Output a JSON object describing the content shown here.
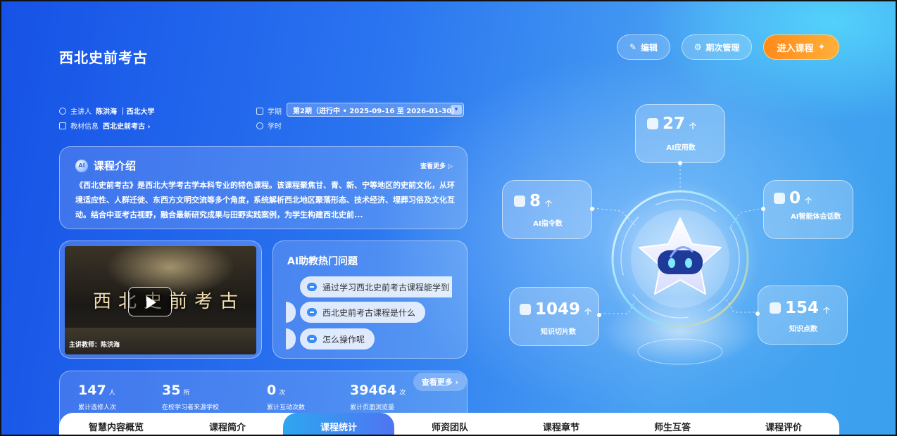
{
  "header": {
    "title": "西北史前考古",
    "edit_label": "编辑",
    "term_mgmt_label": "期次管理",
    "enter_course_label": "进入课程"
  },
  "meta": {
    "lecturer_key": "主讲人",
    "lecturer_value": "陈洪海 ｜西北大学",
    "textbook_key": "教材信息",
    "textbook_value": "西北史前考古 ›",
    "term_key": "学期",
    "term_value": "第2期（进行中 • 2025-09-16 至 2026-01-30）",
    "hours_key": "学时"
  },
  "intro": {
    "title": "课程介绍",
    "badge": "AI",
    "more": "查看更多 ▷",
    "body": "《西北史前考古》是西北大学考古学本科专业的特色课程。该课程聚焦甘、青、新、宁等地区的史前文化，从环境适应性、人群迁徙、东西方文明交流等多个角度，系统解析西北地区聚落形态、技术经济、埋葬习俗及文化互动。结合中亚考古视野，融合最新研究成果与田野实践案例，为学生构建西北史前..."
  },
  "video": {
    "overlay_title": "西北史前考古",
    "teacher_caption": "主讲教师：陈洪海"
  },
  "faq": {
    "title": "AI助教热门问题",
    "questions": [
      "通过学习西北史前考古课程能学到",
      "西北史前考古课程是什么",
      "怎么操作呢"
    ]
  },
  "stats": {
    "more": "查看更多 ›",
    "items": [
      {
        "value": "147",
        "unit": "人",
        "label": "累计选修人次"
      },
      {
        "value": "35",
        "unit": "所",
        "label": "在校学习者来源学校"
      },
      {
        "value": "0",
        "unit": "次",
        "label": "累计互动次数"
      },
      {
        "value": "39464",
        "unit": "次",
        "label": "累计页面浏览量"
      }
    ]
  },
  "metrics": {
    "ai_apps": {
      "value": "27",
      "unit": "个",
      "label": "AI应用数"
    },
    "ai_commands": {
      "value": "8",
      "unit": "个",
      "label": "AI指令数"
    },
    "ai_agents": {
      "value": "0",
      "unit": "个",
      "label": "AI智能体会话数"
    },
    "knowledge_slices": {
      "value": "1049",
      "unit": "个",
      "label": "知识切片数"
    },
    "knowledge_points": {
      "value": "154",
      "unit": "个",
      "label": "知识点数"
    }
  },
  "tabs": [
    "智慧内容概览",
    "课程简介",
    "课程统计",
    "师资团队",
    "课程章节",
    "师生互答",
    "课程评价"
  ],
  "active_tab": "课程统计",
  "colors": {
    "accent_orange": "#ff8a1a",
    "tab_active": "#2ea7f0",
    "bg_blue": "#1e5fe0"
  }
}
